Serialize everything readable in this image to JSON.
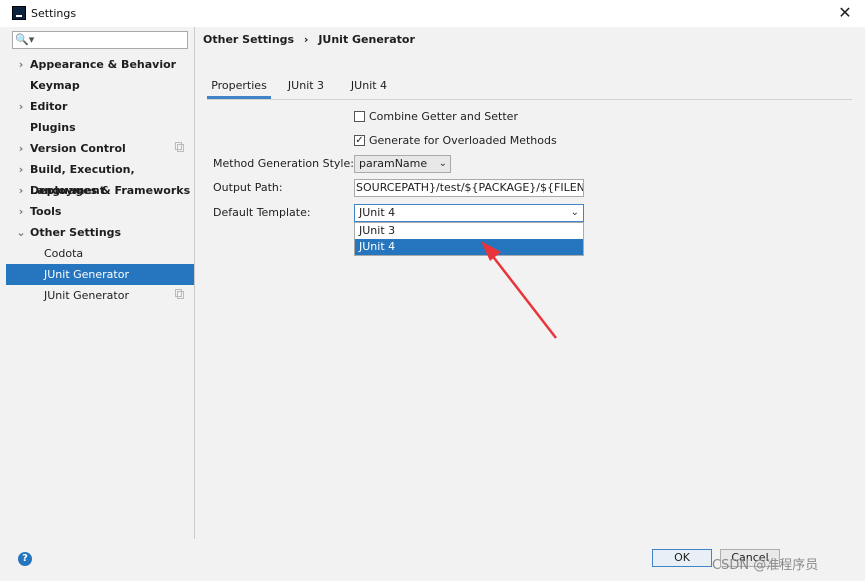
{
  "window": {
    "title": "Settings",
    "close_glyph": "✕",
    "app_icon": "intellij-idea-icon"
  },
  "search": {
    "placeholder": "",
    "icon": "search-icon",
    "glyph": "🔍▾"
  },
  "sidebar": {
    "items": [
      {
        "label": "Appearance & Behavior",
        "arrow": "›",
        "bold": true
      },
      {
        "label": "Keymap",
        "arrow": "",
        "bold": true
      },
      {
        "label": "Editor",
        "arrow": "›",
        "bold": true
      },
      {
        "label": "Plugins",
        "arrow": "",
        "bold": true
      },
      {
        "label": "Version Control",
        "arrow": "›",
        "bold": true,
        "copy": true
      },
      {
        "label": "Build, Execution, Deployment",
        "arrow": "›",
        "bold": true
      },
      {
        "label": "Languages & Frameworks",
        "arrow": "›",
        "bold": true
      },
      {
        "label": "Tools",
        "arrow": "›",
        "bold": true
      },
      {
        "label": "Other Settings",
        "arrow": "⌄",
        "bold": true
      },
      {
        "label": "Codota",
        "arrow": "",
        "bold": false
      },
      {
        "label": "JUnit Generator",
        "arrow": "",
        "bold": false,
        "selected": true
      },
      {
        "label": "JUnit Generator",
        "arrow": "",
        "bold": false,
        "copy": true
      }
    ]
  },
  "breadcrumb": {
    "parent": "Other Settings",
    "separator": "›",
    "current": "JUnit Generator"
  },
  "tabs": [
    {
      "label": "Properties",
      "active": true
    },
    {
      "label": "JUnit 3",
      "active": false
    },
    {
      "label": "JUnit 4",
      "active": false
    }
  ],
  "form": {
    "combine_getter_setter": {
      "label": "Combine Getter and Setter",
      "checked": false,
      "mark": ""
    },
    "generate_overloaded": {
      "label": "Generate for Overloaded Methods",
      "checked": true,
      "mark": "✓"
    },
    "method_style": {
      "label": "Method Generation Style:",
      "value": "paramName",
      "chevron": "⌄"
    },
    "output_path": {
      "label": "Output Path:",
      "value": "SOURCEPATH}/test/${PACKAGE}/${FILENAME}"
    },
    "default_template": {
      "label": "Default Template:",
      "value": "JUnit 4",
      "chevron": "⌄",
      "options": [
        "JUnit 3",
        "JUnit 4"
      ],
      "selected_option": "JUnit 4"
    }
  },
  "footer": {
    "help_glyph": "?",
    "ok_label": "OK",
    "cancel_label": "Cancel"
  },
  "watermark": "CSDN @准程序员",
  "colors": {
    "selection": "#2675bf",
    "accent": "#4083c9",
    "annotation_arrow": "#e8343a"
  }
}
